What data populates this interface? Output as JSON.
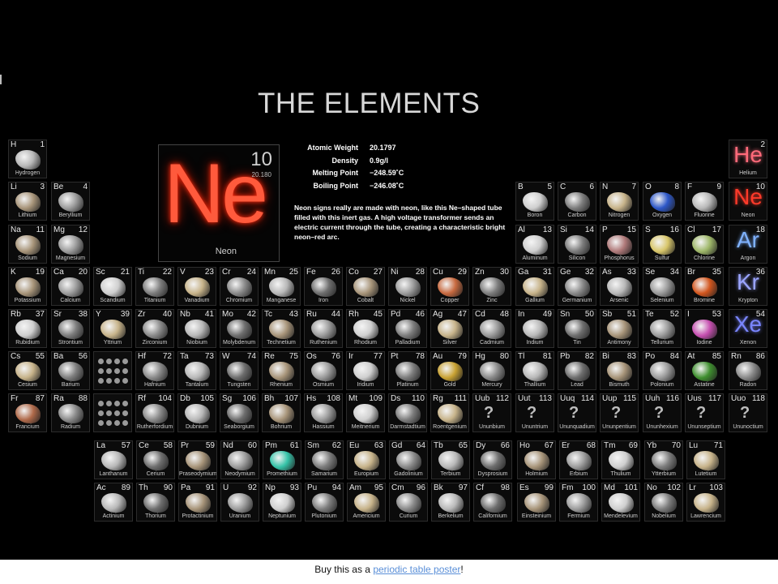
{
  "title": "THE ELEMENTS",
  "featured": {
    "symbol": "Ne",
    "number": "10",
    "weight": "20.180",
    "name": "Neon",
    "properties": [
      {
        "label": "Atomic Weight",
        "value": "20.1797"
      },
      {
        "label": "Density",
        "value": "0.9g/l"
      },
      {
        "label": "Melting Point",
        "value": "−248.59˚C"
      },
      {
        "label": "Boiling Point",
        "value": "−246.08˚C"
      }
    ],
    "description": "Neon signs really are made with neon, like this Ne–shaped tube filled with this inert gas. A high voltage transformer sends an electric current through the tube, creating a characteristic bright neon–red arc."
  },
  "footer": {
    "text_before": "Buy this as a ",
    "link_text": "periodic table poster",
    "text_after": "!"
  },
  "elements": [
    {
      "s": "H",
      "n": "1",
      "name": "Hydrogen"
    },
    {
      "s": "He",
      "n": "2",
      "name": "Helium"
    },
    {
      "s": "Li",
      "n": "3",
      "name": "Lithium"
    },
    {
      "s": "Be",
      "n": "4",
      "name": "Beryllium"
    },
    {
      "s": "B",
      "n": "5",
      "name": "Boron"
    },
    {
      "s": "C",
      "n": "6",
      "name": "Carbon"
    },
    {
      "s": "N",
      "n": "7",
      "name": "Nitrogen"
    },
    {
      "s": "O",
      "n": "8",
      "name": "Oxygen"
    },
    {
      "s": "F",
      "n": "9",
      "name": "Fluorine"
    },
    {
      "s": "Ne",
      "n": "10",
      "name": "Neon"
    },
    {
      "s": "Na",
      "n": "11",
      "name": "Sodium"
    },
    {
      "s": "Mg",
      "n": "12",
      "name": "Magnesium"
    },
    {
      "s": "Al",
      "n": "13",
      "name": "Aluminum"
    },
    {
      "s": "Si",
      "n": "14",
      "name": "Silicon"
    },
    {
      "s": "P",
      "n": "15",
      "name": "Phosphorus"
    },
    {
      "s": "S",
      "n": "16",
      "name": "Sulfur"
    },
    {
      "s": "Cl",
      "n": "17",
      "name": "Chlorine"
    },
    {
      "s": "Ar",
      "n": "18",
      "name": "Argon"
    },
    {
      "s": "K",
      "n": "19",
      "name": "Potassium"
    },
    {
      "s": "Ca",
      "n": "20",
      "name": "Calcium"
    },
    {
      "s": "Sc",
      "n": "21",
      "name": "Scandium"
    },
    {
      "s": "Ti",
      "n": "22",
      "name": "Titanium"
    },
    {
      "s": "V",
      "n": "23",
      "name": "Vanadium"
    },
    {
      "s": "Cr",
      "n": "24",
      "name": "Chromium"
    },
    {
      "s": "Mn",
      "n": "25",
      "name": "Manganese"
    },
    {
      "s": "Fe",
      "n": "26",
      "name": "Iron"
    },
    {
      "s": "Co",
      "n": "27",
      "name": "Cobalt"
    },
    {
      "s": "Ni",
      "n": "28",
      "name": "Nickel"
    },
    {
      "s": "Cu",
      "n": "29",
      "name": "Copper"
    },
    {
      "s": "Zn",
      "n": "30",
      "name": "Zinc"
    },
    {
      "s": "Ga",
      "n": "31",
      "name": "Gallium"
    },
    {
      "s": "Ge",
      "n": "32",
      "name": "Germanium"
    },
    {
      "s": "As",
      "n": "33",
      "name": "Arsenic"
    },
    {
      "s": "Se",
      "n": "34",
      "name": "Selenium"
    },
    {
      "s": "Br",
      "n": "35",
      "name": "Bromine"
    },
    {
      "s": "Kr",
      "n": "36",
      "name": "Krypton"
    },
    {
      "s": "Rb",
      "n": "37",
      "name": "Rubidium"
    },
    {
      "s": "Sr",
      "n": "38",
      "name": "Strontium"
    },
    {
      "s": "Y",
      "n": "39",
      "name": "Yttrium"
    },
    {
      "s": "Zr",
      "n": "40",
      "name": "Zirconium"
    },
    {
      "s": "Nb",
      "n": "41",
      "name": "Niobium"
    },
    {
      "s": "Mo",
      "n": "42",
      "name": "Molybdenum"
    },
    {
      "s": "Tc",
      "n": "43",
      "name": "Technetium"
    },
    {
      "s": "Ru",
      "n": "44",
      "name": "Ruthenium"
    },
    {
      "s": "Rh",
      "n": "45",
      "name": "Rhodium"
    },
    {
      "s": "Pd",
      "n": "46",
      "name": "Palladium"
    },
    {
      "s": "Ag",
      "n": "47",
      "name": "Silver"
    },
    {
      "s": "Cd",
      "n": "48",
      "name": "Cadmium"
    },
    {
      "s": "In",
      "n": "49",
      "name": "Indium"
    },
    {
      "s": "Sn",
      "n": "50",
      "name": "Tin"
    },
    {
      "s": "Sb",
      "n": "51",
      "name": "Antimony"
    },
    {
      "s": "Te",
      "n": "52",
      "name": "Tellurium"
    },
    {
      "s": "I",
      "n": "53",
      "name": "Iodine"
    },
    {
      "s": "Xe",
      "n": "54",
      "name": "Xenon"
    },
    {
      "s": "Cs",
      "n": "55",
      "name": "Cesium"
    },
    {
      "s": "Ba",
      "n": "56",
      "name": "Barium"
    },
    {
      "s": "Hf",
      "n": "72",
      "name": "Hafnium"
    },
    {
      "s": "Ta",
      "n": "73",
      "name": "Tantalum"
    },
    {
      "s": "W",
      "n": "74",
      "name": "Tungsten"
    },
    {
      "s": "Re",
      "n": "75",
      "name": "Rhenium"
    },
    {
      "s": "Os",
      "n": "76",
      "name": "Osmium"
    },
    {
      "s": "Ir",
      "n": "77",
      "name": "Iridium"
    },
    {
      "s": "Pt",
      "n": "78",
      "name": "Platinum"
    },
    {
      "s": "Au",
      "n": "79",
      "name": "Gold"
    },
    {
      "s": "Hg",
      "n": "80",
      "name": "Mercury"
    },
    {
      "s": "Tl",
      "n": "81",
      "name": "Thallium"
    },
    {
      "s": "Pb",
      "n": "82",
      "name": "Lead"
    },
    {
      "s": "Bi",
      "n": "83",
      "name": "Bismuth"
    },
    {
      "s": "Po",
      "n": "84",
      "name": "Polonium"
    },
    {
      "s": "At",
      "n": "85",
      "name": "Astatine"
    },
    {
      "s": "Rn",
      "n": "86",
      "name": "Radon"
    },
    {
      "s": "Fr",
      "n": "87",
      "name": "Francium"
    },
    {
      "s": "Ra",
      "n": "88",
      "name": "Radium"
    },
    {
      "s": "Rf",
      "n": "104",
      "name": "Rutherfordium"
    },
    {
      "s": "Db",
      "n": "105",
      "name": "Dubnium"
    },
    {
      "s": "Sg",
      "n": "106",
      "name": "Seaborgium"
    },
    {
      "s": "Bh",
      "n": "107",
      "name": "Bohrium"
    },
    {
      "s": "Hs",
      "n": "108",
      "name": "Hassium"
    },
    {
      "s": "Mt",
      "n": "109",
      "name": "Meitnerium"
    },
    {
      "s": "Ds",
      "n": "110",
      "name": "Darmstadtium"
    },
    {
      "s": "Rg",
      "n": "111",
      "name": "Roentgenium"
    },
    {
      "s": "Uub",
      "n": "112",
      "name": "Ununbium"
    },
    {
      "s": "Uut",
      "n": "113",
      "name": "Ununtrium"
    },
    {
      "s": "Uuq",
      "n": "114",
      "name": "Ununquadium"
    },
    {
      "s": "Uup",
      "n": "115",
      "name": "Ununpentium"
    },
    {
      "s": "Uuh",
      "n": "116",
      "name": "Ununhexium"
    },
    {
      "s": "Uus",
      "n": "117",
      "name": "Ununseptium"
    },
    {
      "s": "Uuo",
      "n": "118",
      "name": "Ununoctium"
    },
    {
      "s": "La",
      "n": "57",
      "name": "Lanthanum"
    },
    {
      "s": "Ce",
      "n": "58",
      "name": "Cerium"
    },
    {
      "s": "Pr",
      "n": "59",
      "name": "Praseodymium"
    },
    {
      "s": "Nd",
      "n": "60",
      "name": "Neodymium"
    },
    {
      "s": "Pm",
      "n": "61",
      "name": "Promethium"
    },
    {
      "s": "Sm",
      "n": "62",
      "name": "Samarium"
    },
    {
      "s": "Eu",
      "n": "63",
      "name": "Europium"
    },
    {
      "s": "Gd",
      "n": "64",
      "name": "Gadolinium"
    },
    {
      "s": "Tb",
      "n": "65",
      "name": "Terbium"
    },
    {
      "s": "Dy",
      "n": "66",
      "name": "Dysprosium"
    },
    {
      "s": "Ho",
      "n": "67",
      "name": "Holmium"
    },
    {
      "s": "Er",
      "n": "68",
      "name": "Erbium"
    },
    {
      "s": "Tm",
      "n": "69",
      "name": "Thulium"
    },
    {
      "s": "Yb",
      "n": "70",
      "name": "Ytterbium"
    },
    {
      "s": "Lu",
      "n": "71",
      "name": "Lutetium"
    },
    {
      "s": "Ac",
      "n": "89",
      "name": "Actinium"
    },
    {
      "s": "Th",
      "n": "90",
      "name": "Thorium"
    },
    {
      "s": "Pa",
      "n": "91",
      "name": "Protactinium"
    },
    {
      "s": "U",
      "n": "92",
      "name": "Uranium"
    },
    {
      "s": "Np",
      "n": "93",
      "name": "Neptunium"
    },
    {
      "s": "Pu",
      "n": "94",
      "name": "Plutonium"
    },
    {
      "s": "Am",
      "n": "95",
      "name": "Americium"
    },
    {
      "s": "Cm",
      "n": "96",
      "name": "Curium"
    },
    {
      "s": "Bk",
      "n": "97",
      "name": "Berkelium"
    },
    {
      "s": "Cf",
      "n": "98",
      "name": "Californium"
    },
    {
      "s": "Es",
      "n": "99",
      "name": "Einsteinium"
    },
    {
      "s": "Fm",
      "n": "100",
      "name": "Fermium"
    },
    {
      "s": "Md",
      "n": "101",
      "name": "Mendelevium"
    },
    {
      "s": "No",
      "n": "102",
      "name": "Nobelium"
    },
    {
      "s": "Lr",
      "n": "103",
      "name": "Lawrencium"
    }
  ]
}
